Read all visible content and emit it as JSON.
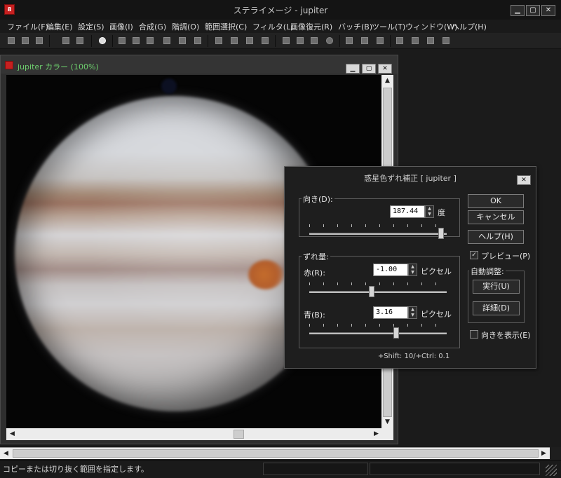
{
  "window": {
    "title": "ステライメージ - jupiter",
    "app_icon_glyph": "8",
    "minimize": "▁",
    "maximize": "▢",
    "close": "✕"
  },
  "menu": [
    "ファイル(F)",
    "編集(E)",
    "設定(S)",
    "画像(I)",
    "合成(G)",
    "階調(O)",
    "範囲選択(C)",
    "フィルタ(L)",
    "画像復元(R)",
    "バッチ(B)",
    "ツール(T)",
    "ウィンドウ(W)",
    "ヘルプ(H)"
  ],
  "image_window": {
    "title": "jupiter カラー (100%)",
    "minimize": "▁",
    "maximize": "▢",
    "close": "✕"
  },
  "status": {
    "text": "コピーまたは切り抜く範囲を指定します。"
  },
  "dialog": {
    "title": "惑星色ずれ補正 [ jupiter ]",
    "close": "✕",
    "direction": {
      "group_label": "向き(D):",
      "value": "187.44",
      "unit": "度",
      "slider_fraction": 0.98
    },
    "shift": {
      "group_label": "ずれ量:",
      "red": {
        "label": "赤(R):",
        "value": "-1.00",
        "unit": "ピクセル",
        "slider_fraction": 0.45
      },
      "blue": {
        "label": "青(B):",
        "value": "3.16",
        "unit": "ピクセル",
        "slider_fraction": 0.64
      }
    },
    "hint": "+Shift: 10/+Ctrl: 0.1",
    "buttons": {
      "ok": "OK",
      "cancel": "キャンセル",
      "help": "ヘルプ(H)"
    },
    "preview": {
      "label": "プレビュー(P)",
      "checked": true,
      "mark": "✓"
    },
    "auto": {
      "group_label": "自動調整:",
      "run": "実行(U)",
      "detail": "詳細(D)"
    },
    "show_direction": {
      "label": "向きを表示(E)",
      "checked": false
    }
  }
}
